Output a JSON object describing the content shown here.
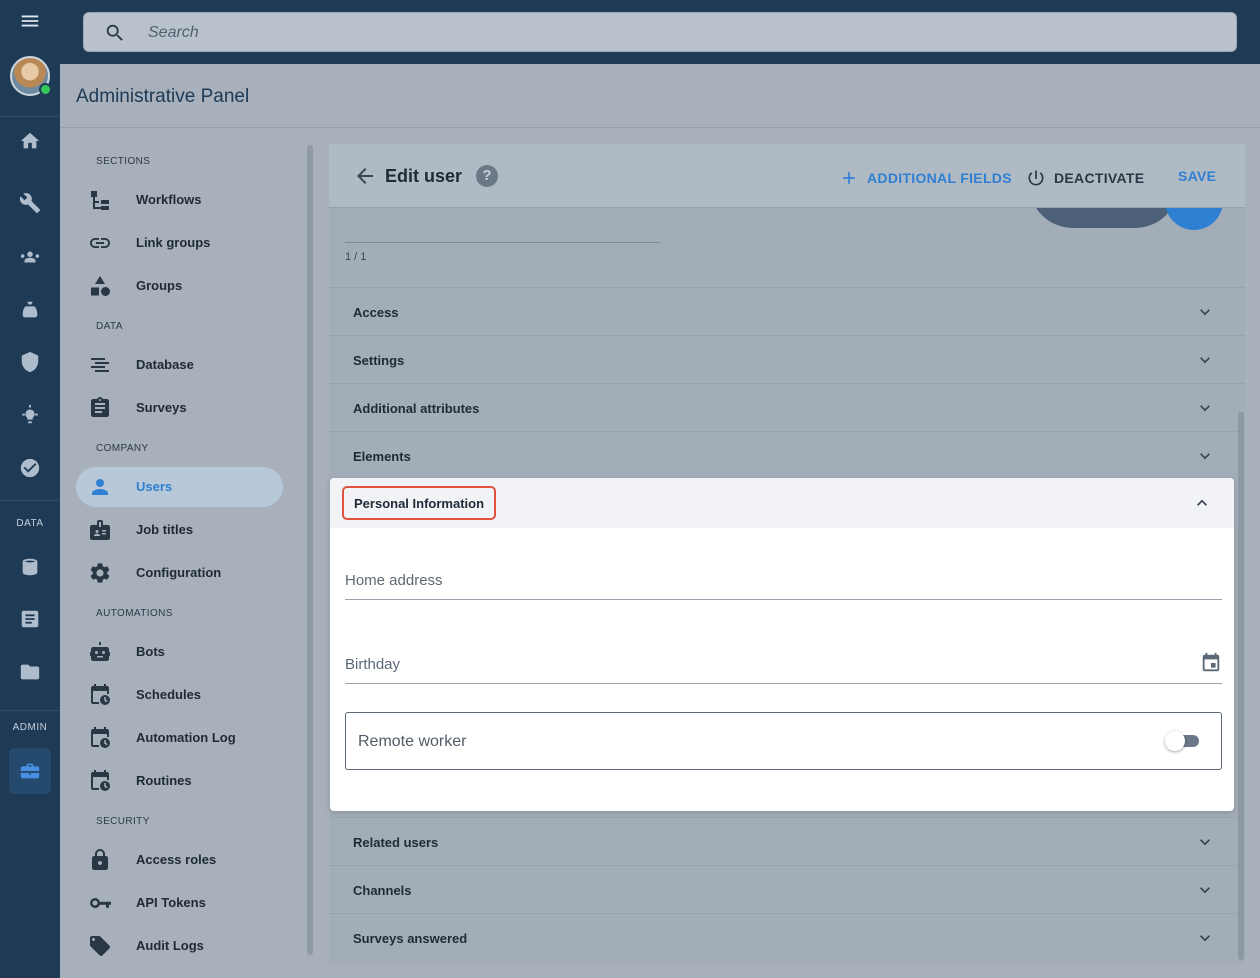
{
  "search": {
    "placeholder": "Search"
  },
  "header": {
    "title": "Administrative Panel"
  },
  "rail": {
    "sections": [
      "DATA",
      "ADMIN"
    ]
  },
  "sidebar": {
    "sections": {
      "sections": "SECTIONS",
      "data": "DATA",
      "company": "COMPANY",
      "automations": "AUTOMATIONS",
      "security": "SECURITY"
    },
    "items": [
      {
        "label": "Workflows",
        "icon": "workflow-icon"
      },
      {
        "label": "Link groups",
        "icon": "link-icon"
      },
      {
        "label": "Groups",
        "icon": "shapes-icon"
      },
      {
        "label": "Database",
        "icon": "list-icon"
      },
      {
        "label": "Surveys",
        "icon": "clipboard-icon"
      },
      {
        "label": "Users",
        "icon": "person-icon",
        "active": true
      },
      {
        "label": "Job titles",
        "icon": "badge-icon"
      },
      {
        "label": "Configuration",
        "icon": "gear-icon"
      },
      {
        "label": "Bots",
        "icon": "robot-icon"
      },
      {
        "label": "Schedules",
        "icon": "calendar-clock-icon"
      },
      {
        "label": "Automation Log",
        "icon": "calendar-clock-icon"
      },
      {
        "label": "Routines",
        "icon": "calendar-clock-icon"
      },
      {
        "label": "Access roles",
        "icon": "lock-icon"
      },
      {
        "label": "API Tokens",
        "icon": "key-icon"
      },
      {
        "label": "Audit Logs",
        "icon": "tag-icon"
      }
    ]
  },
  "editor": {
    "title": "Edit user",
    "help": "?",
    "additional_fields": "ADDITIONAL FIELDS",
    "deactivate": "DEACTIVATE",
    "save": "SAVE",
    "counter": "1 / 1",
    "accordions_top": [
      "Access",
      "Settings",
      "Additional attributes",
      "Elements"
    ],
    "expanded": {
      "title": "Personal Information",
      "home_address_label": "Home address",
      "birthday_label": "Birthday",
      "remote_worker_label": "Remote worker",
      "remote_worker_on": false
    },
    "accordions_bottom": [
      "Related users",
      "Channels",
      "Surveys answered"
    ]
  },
  "colors": {
    "accent": "#2f7fd3",
    "rail": "#1e3a55",
    "highlight": "#e2513f"
  }
}
